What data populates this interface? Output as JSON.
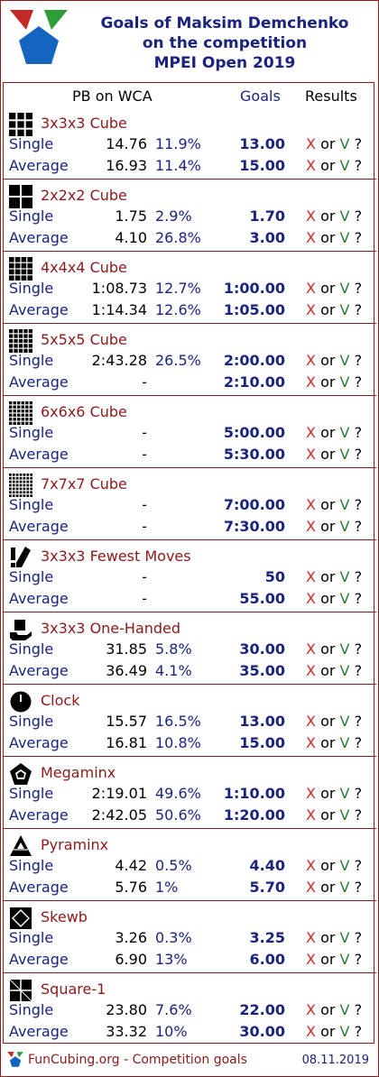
{
  "header": {
    "title_line1": "Goals of Maksim Demchenko",
    "title_line2": "on the competition",
    "title_line3": "MPEI Open 2019"
  },
  "columns": {
    "pb": "PB on WCA",
    "goals": "Goals",
    "results": "Results"
  },
  "result_tokens": {
    "x": "X",
    "or": "or",
    "v": "V",
    "q": "?"
  },
  "events": [
    {
      "name": "3x3x3 Cube",
      "icon": "grid-3-icon",
      "single": {
        "type": "Single",
        "pb": "14.76",
        "pct": "11.9%",
        "goal": "13.00"
      },
      "average": {
        "type": "Average",
        "pb": "16.93",
        "pct": "11.4%",
        "goal": "15.00"
      }
    },
    {
      "name": "2x2x2 Cube",
      "icon": "grid-2-icon",
      "single": {
        "type": "Single",
        "pb": "1.75",
        "pct": "2.9%",
        "goal": "1.70"
      },
      "average": {
        "type": "Average",
        "pb": "4.10",
        "pct": "26.8%",
        "goal": "3.00"
      }
    },
    {
      "name": "4x4x4 Cube",
      "icon": "grid-4-icon",
      "single": {
        "type": "Single",
        "pb": "1:08.73",
        "pct": "12.7%",
        "goal": "1:00.00"
      },
      "average": {
        "type": "Average",
        "pb": "1:14.34",
        "pct": "12.6%",
        "goal": "1:05.00"
      }
    },
    {
      "name": "5x5x5 Cube",
      "icon": "grid-5-icon",
      "single": {
        "type": "Single",
        "pb": "2:43.28",
        "pct": "26.5%",
        "goal": "2:00.00"
      },
      "average": {
        "type": "Average",
        "pb": "-",
        "pct": "",
        "goal": "2:10.00"
      }
    },
    {
      "name": "6x6x6 Cube",
      "icon": "grid-6-icon",
      "single": {
        "type": "Single",
        "pb": "-",
        "pct": "",
        "goal": "5:00.00"
      },
      "average": {
        "type": "Average",
        "pb": "-",
        "pct": "",
        "goal": "5:30.00"
      }
    },
    {
      "name": "7x7x7 Cube",
      "icon": "grid-7-icon",
      "single": {
        "type": "Single",
        "pb": "-",
        "pct": "",
        "goal": "7:00.00"
      },
      "average": {
        "type": "Average",
        "pb": "-",
        "pct": "",
        "goal": "7:30.00"
      }
    },
    {
      "name": "3x3x3 Fewest Moves",
      "icon": "fewest-moves-icon",
      "single": {
        "type": "Single",
        "pb": "-",
        "pct": "",
        "goal": "50"
      },
      "average": {
        "type": "Average",
        "pb": "-",
        "pct": "",
        "goal": "55.00"
      }
    },
    {
      "name": "3x3x3 One-Handed",
      "icon": "one-handed-icon",
      "single": {
        "type": "Single",
        "pb": "31.85",
        "pct": "5.8%",
        "goal": "30.00"
      },
      "average": {
        "type": "Average",
        "pb": "36.49",
        "pct": "4.1%",
        "goal": "35.00"
      }
    },
    {
      "name": "Clock",
      "icon": "clock-icon",
      "single": {
        "type": "Single",
        "pb": "15.57",
        "pct": "16.5%",
        "goal": "13.00"
      },
      "average": {
        "type": "Average",
        "pb": "16.81",
        "pct": "10.8%",
        "goal": "15.00"
      }
    },
    {
      "name": "Megaminx",
      "icon": "megaminx-icon",
      "single": {
        "type": "Single",
        "pb": "2:19.01",
        "pct": "49.6%",
        "goal": "1:10.00"
      },
      "average": {
        "type": "Average",
        "pb": "2:42.05",
        "pct": "50.6%",
        "goal": "1:20.00"
      }
    },
    {
      "name": "Pyraminx",
      "icon": "pyraminx-icon",
      "single": {
        "type": "Single",
        "pb": "4.42",
        "pct": "0.5%",
        "goal": "4.40"
      },
      "average": {
        "type": "Average",
        "pb": "5.76",
        "pct": "1%",
        "goal": "5.70"
      }
    },
    {
      "name": "Skewb",
      "icon": "skewb-icon",
      "single": {
        "type": "Single",
        "pb": "3.26",
        "pct": "0.3%",
        "goal": "3.25"
      },
      "average": {
        "type": "Average",
        "pb": "6.90",
        "pct": "13%",
        "goal": "6.00"
      }
    },
    {
      "name": "Square-1",
      "icon": "square1-icon",
      "single": {
        "type": "Single",
        "pb": "23.80",
        "pct": "7.6%",
        "goal": "22.00"
      },
      "average": {
        "type": "Average",
        "pb": "33.32",
        "pct": "10%",
        "goal": "30.00"
      }
    }
  ],
  "footer": {
    "site": "FunCubing.org - Competition goals",
    "date": "08.11.2019"
  },
  "colors": {
    "border": "#8b1a1a",
    "navy": "#1a237e",
    "x": "#c62828",
    "v": "#2e7d32"
  }
}
